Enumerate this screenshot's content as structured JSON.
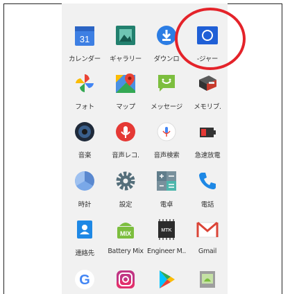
{
  "apps": [
    {
      "label": "カレンダー",
      "icon": "calendar-icon",
      "text": "31"
    },
    {
      "label": "ギャラリー",
      "icon": "gallery-icon"
    },
    {
      "label": "ダウンロ",
      "icon": "download-icon"
    },
    {
      "label": "-ジャー",
      "icon": "file-manager-icon"
    },
    {
      "label": "フォト",
      "icon": "photos-icon"
    },
    {
      "label": "マップ",
      "icon": "maps-icon"
    },
    {
      "label": "メッセージ",
      "icon": "messages-icon"
    },
    {
      "label": "メモリブ.",
      "icon": "memory-booster-icon"
    },
    {
      "label": "音楽",
      "icon": "music-icon"
    },
    {
      "label": "音声レコ.",
      "icon": "voice-recorder-icon"
    },
    {
      "label": "音声検索",
      "icon": "voice-search-icon"
    },
    {
      "label": "急速放電",
      "icon": "battery-discharge-icon"
    },
    {
      "label": "時計",
      "icon": "clock-icon"
    },
    {
      "label": "設定",
      "icon": "settings-icon"
    },
    {
      "label": "電卓",
      "icon": "calculator-icon"
    },
    {
      "label": "電話",
      "icon": "phone-icon"
    },
    {
      "label": "連絡先",
      "icon": "contacts-icon"
    },
    {
      "label": "Battery Mix",
      "icon": "battery-mix-icon",
      "text": "MIX"
    },
    {
      "label": "Engineer M..",
      "icon": "engineer-mode-icon",
      "text": "MTK"
    },
    {
      "label": "Gmail",
      "icon": "gmail-icon",
      "text": "M"
    },
    {
      "label": "",
      "icon": "google-icon",
      "text": "G"
    },
    {
      "label": "",
      "icon": "instagram-icon"
    },
    {
      "label": "",
      "icon": "play-store-icon"
    },
    {
      "label": "",
      "icon": "android-app-icon"
    }
  ],
  "colors": {
    "highlight": "#e4232a",
    "background": "#f1f1f1"
  }
}
